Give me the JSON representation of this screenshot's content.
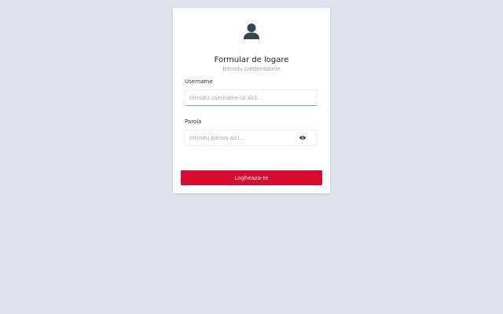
{
  "form": {
    "title": "Formular de logare",
    "subtitle": "Introdu credentialele",
    "username": {
      "label": "Username",
      "placeholder": "Introdu username-ul aici...",
      "value": ""
    },
    "password": {
      "label": "Parola",
      "placeholder": "Introdu parola aici...",
      "value": ""
    },
    "submit_label": "Logheaza-te"
  },
  "icons": {
    "header": "user-icon",
    "password_toggle": "eye-icon"
  },
  "colors": {
    "background": "#e1e3ec",
    "primary_button": "#db0a2f",
    "focus_underline": "#4fb5ad",
    "icon": "#37474f"
  }
}
